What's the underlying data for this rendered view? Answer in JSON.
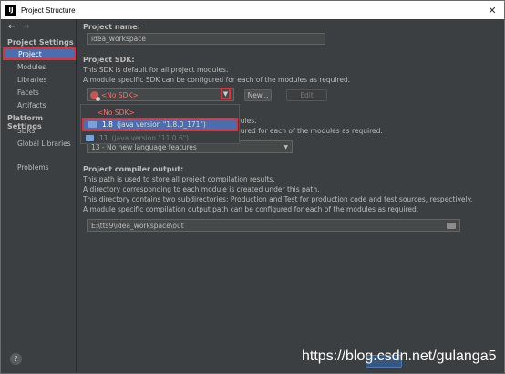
{
  "window": {
    "title": "Project Structure",
    "app_icon": "IJ",
    "close": "✕"
  },
  "sidebar": {
    "nav_back": "←",
    "nav_forward": "→",
    "project_settings_heading": "Project Settings",
    "project_settings_items": [
      "Project",
      "Modules",
      "Libraries",
      "Facets",
      "Artifacts"
    ],
    "platform_settings_heading": "Platform Settings",
    "platform_settings_items": [
      "SDKs",
      "Global Libraries"
    ],
    "problems": "Problems",
    "help": "?"
  },
  "main": {
    "project_name_label": "Project name:",
    "project_name_value": "idea_workspace",
    "project_sdk_label": "Project SDK:",
    "project_sdk_desc1": "This SDK is default for all project modules.",
    "project_sdk_desc2": "A module specific SDK can be configured for each of the modules as required.",
    "sdk_selected": "<No SDK>",
    "sdk_dropdown_arrow": "▼",
    "new_button": "New...",
    "edit_button": "Edit",
    "language_level_label_fragment": "P",
    "language_level_desc1_fragment": "dules.",
    "language_level_desc2_fragment": "gured for each of the modules as required.",
    "language_level_value": "13 - No new language features",
    "language_level_arrow": "▼",
    "compiler_output_label": "Project compiler output:",
    "compiler_output_desc1": "This path is used to store all project compilation results.",
    "compiler_output_desc2": "A directory corresponding to each module is created under this path.",
    "compiler_output_desc3": "This directory contains two subdirectories: Production and Test for production code and test sources, respectively.",
    "compiler_output_desc4": "A module specific compilation output path can be configured for each of the modules as required.",
    "compiler_output_value": "E:\\tts9\\idea_workspace\\out"
  },
  "sdk_popup": {
    "no_sdk": "<No SDK>",
    "options": [
      {
        "name": "1.8",
        "version": "(java version \"1.8.0_171\")"
      },
      {
        "name": "11",
        "version": "(java version \"11.0.6\")"
      }
    ]
  },
  "watermark": "https://blog.csdn.net/gulanga5",
  "colors": {
    "accent": "#4b6eaf",
    "highlight_border": "#e0303a",
    "no_sdk": "#ff6b68"
  }
}
